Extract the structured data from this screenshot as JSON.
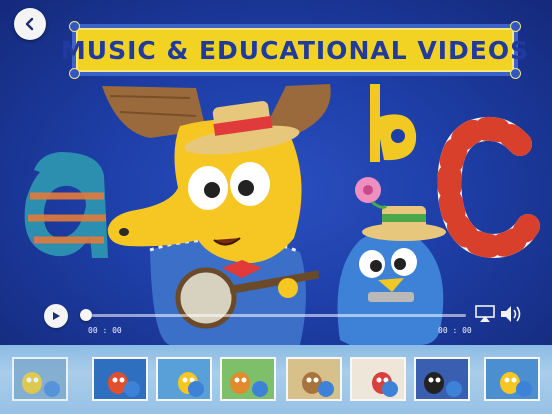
{
  "header": {
    "title": "MUSIC & EDUCATIONAL VIDEOS",
    "back_icon": "chevron-left-icon"
  },
  "player": {
    "elapsed": "00 : 00",
    "duration": "00 : 00",
    "progress": 0,
    "icons": [
      "play-icon",
      "airplay-icon",
      "volume-icon"
    ]
  },
  "thumbnails": {
    "count": 8,
    "selected_index": 0
  },
  "colors": {
    "sign_yellow": "#f2d324",
    "title_blue": "#203a9e",
    "scene_blue": "#1e3fa8",
    "strip_blue": "#97c1e5",
    "moose_yellow": "#f6c623"
  }
}
